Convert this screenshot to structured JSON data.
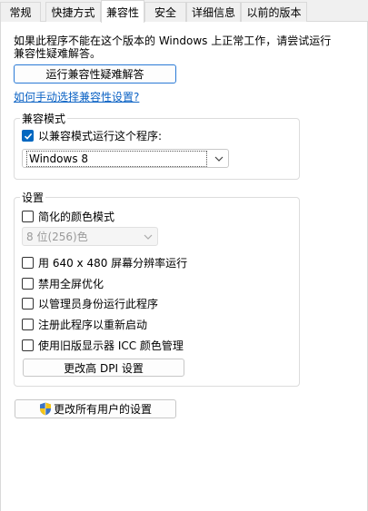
{
  "tabs": [
    {
      "label": "常规"
    },
    {
      "label": "快捷方式"
    },
    {
      "label": "兼容性"
    },
    {
      "label": "安全"
    },
    {
      "label": "详细信息"
    },
    {
      "label": "以前的版本"
    }
  ],
  "active_tab": "兼容性",
  "description": "如果此程序不能在这个版本的 Windows 上正常工作，请尝试运行兼容性疑难解答。",
  "troubleshooter_button": "运行兼容性疑难解答",
  "manual_link": "如何手动选择兼容性设置?",
  "compat_mode": {
    "legend": "兼容模式",
    "checkbox_label": "以兼容模式运行这个程序:",
    "checked": true,
    "selected_os": "Windows 8"
  },
  "settings": {
    "legend": "设置",
    "reduced_color": {
      "label": "简化的颜色模式",
      "checked": false
    },
    "color_select": "8 位(256)色",
    "res_640": {
      "label": "用 640 x 480 屏幕分辨率运行",
      "checked": false
    },
    "disable_fullscreen": {
      "label": "禁用全屏优化",
      "checked": false
    },
    "run_as_admin": {
      "label": "以管理员身份运行此程序",
      "checked": false
    },
    "register_restart": {
      "label": "注册此程序以重新启动",
      "checked": false
    },
    "legacy_icc": {
      "label": "使用旧版显示器 ICC 颜色管理",
      "checked": false
    },
    "dpi_button": "更改高 DPI 设置"
  },
  "all_users_button": "更改所有用户的设置",
  "colors": {
    "accent": "#0067c0",
    "link": "#0b62c4"
  }
}
